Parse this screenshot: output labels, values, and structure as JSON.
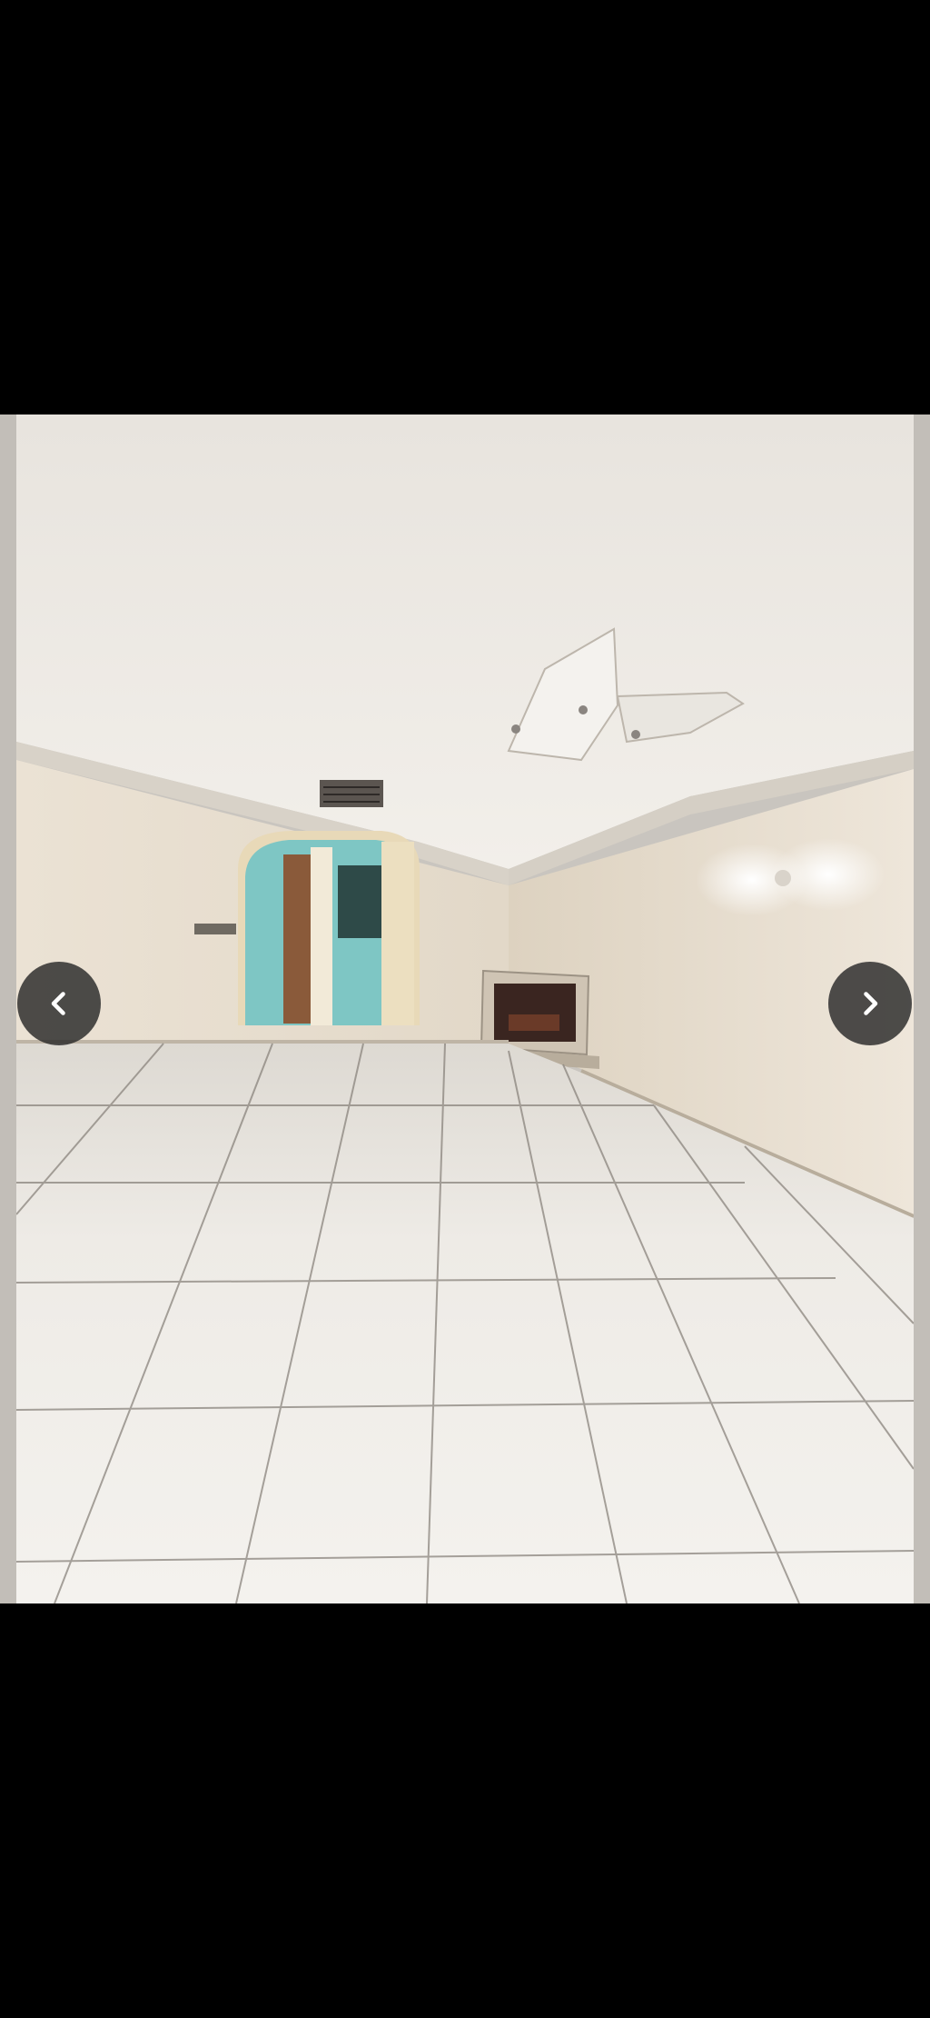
{
  "viewer": {
    "photo": {
      "alt": "",
      "colors": {
        "ceiling": "#ece8e2",
        "wall": "#e6dccd",
        "floor": "#ece9e4",
        "grout": "#7c7670",
        "doorway": "#7bc7c6",
        "fireplace": "#3a2520"
      }
    },
    "controls": {
      "previous_icon": "chevron-left-icon",
      "next_icon": "chevron-right-icon",
      "button_color": "#2b2b2b",
      "icon_color": "#ffffff"
    }
  }
}
